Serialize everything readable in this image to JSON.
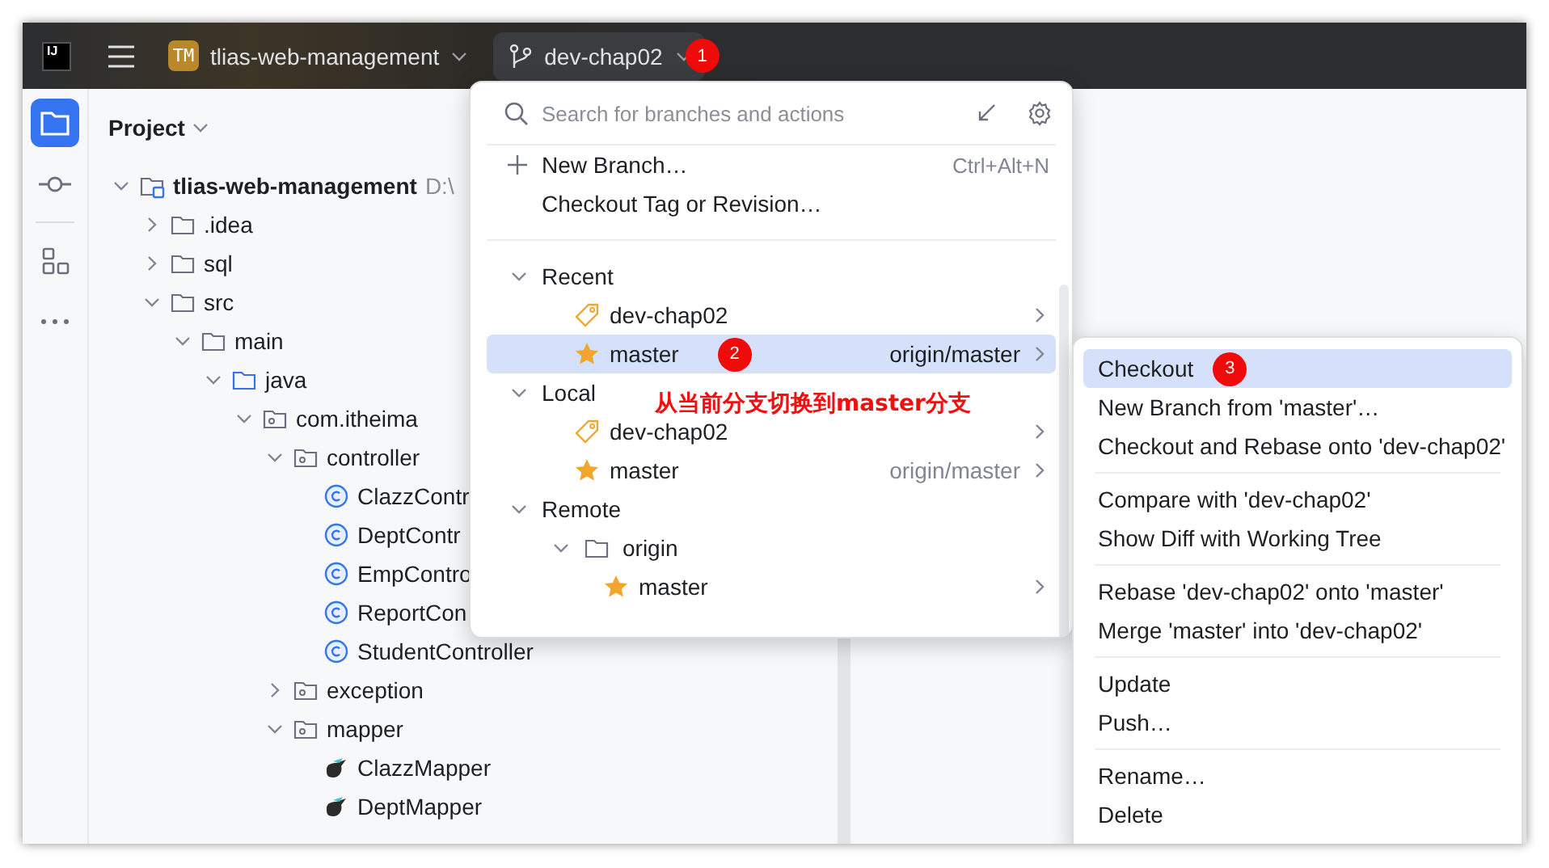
{
  "title_bar": {
    "logo_text": "IJ",
    "project_badge": "TM",
    "project_name": "tlias-web-management",
    "branch": "dev-chap02",
    "branch_badge": "1"
  },
  "tool_strip": [
    {
      "kind": "project",
      "selected": true
    },
    {
      "kind": "commit",
      "selected": false
    },
    {
      "kind": "structure",
      "selected": false
    },
    {
      "kind": "more",
      "selected": false
    }
  ],
  "project_panel": {
    "title": "Project",
    "tree": [
      {
        "label": "tlias-web-management",
        "path": "D:\\",
        "kind": "module",
        "expanded": true,
        "children": [
          {
            "label": ".idea",
            "kind": "folder",
            "expanded": false
          },
          {
            "label": "sql",
            "kind": "folder",
            "expanded": false
          },
          {
            "label": "src",
            "kind": "folder",
            "expanded": true,
            "children": [
              {
                "label": "main",
                "kind": "folder",
                "expanded": true,
                "children": [
                  {
                    "label": "java",
                    "kind": "source-folder",
                    "expanded": true,
                    "children": [
                      {
                        "label": "com.itheima",
                        "kind": "package",
                        "expanded": true,
                        "children": [
                          {
                            "label": "controller",
                            "kind": "package",
                            "expanded": true,
                            "children": [
                              {
                                "label": "ClazzContr",
                                "kind": "class"
                              },
                              {
                                "label": "DeptContr",
                                "kind": "class"
                              },
                              {
                                "label": "EmpContro",
                                "kind": "class"
                              },
                              {
                                "label": "ReportCon",
                                "kind": "class"
                              },
                              {
                                "label": "StudentController",
                                "kind": "class"
                              }
                            ]
                          },
                          {
                            "label": "exception",
                            "kind": "package",
                            "expanded": false
                          },
                          {
                            "label": "mapper",
                            "kind": "package",
                            "expanded": true,
                            "children": [
                              {
                                "label": "ClazzMapper",
                                "kind": "mapper"
                              },
                              {
                                "label": "DeptMapper",
                                "kind": "mapper"
                              }
                            ]
                          }
                        ]
                      }
                    ]
                  }
                ]
              }
            ]
          }
        ]
      }
    ]
  },
  "branch_popup": {
    "search": {
      "placeholder": "Search for branches and actions"
    },
    "actions": [
      {
        "label": "New Branch…",
        "shortcut": "Ctrl+Alt+N",
        "kind": "create"
      },
      {
        "label": "Checkout Tag or Revision…",
        "kind": "plain"
      }
    ],
    "sections": [
      {
        "title": "Recent",
        "expanded": true,
        "items": [
          {
            "name": "dev-chap02",
            "kind": "tag",
            "selected": false
          },
          {
            "name": "master",
            "kind": "star",
            "tracking": "origin/master",
            "selected": true,
            "badge": "2"
          }
        ]
      },
      {
        "title": "Local",
        "expanded": true,
        "items": [
          {
            "name": "dev-chap02",
            "kind": "tag",
            "selected": false
          },
          {
            "name": "master",
            "kind": "star",
            "tracking": "origin/master",
            "selected": false
          }
        ]
      },
      {
        "title": "Remote",
        "expanded": true,
        "groups": [
          {
            "name": "origin",
            "expanded": true,
            "items": [
              {
                "name": "master",
                "kind": "star",
                "selected": false
              }
            ]
          }
        ]
      }
    ],
    "note": "从当前分支切换到master分支"
  },
  "context_menu": {
    "groups": [
      [
        {
          "label": "Checkout",
          "selected": true,
          "badge": "3"
        },
        {
          "label": "New Branch from 'master'…",
          "selected": false
        },
        {
          "label": "Checkout and Rebase onto 'dev-chap02'",
          "selected": false
        }
      ],
      [
        {
          "label": "Compare with 'dev-chap02'",
          "selected": false
        },
        {
          "label": "Show Diff with Working Tree",
          "selected": false
        }
      ],
      [
        {
          "label": "Rebase 'dev-chap02' onto 'master'",
          "selected": false
        },
        {
          "label": "Merge 'master' into 'dev-chap02'",
          "selected": false
        }
      ],
      [
        {
          "label": "Update",
          "selected": false
        },
        {
          "label": "Push…",
          "selected": false
        }
      ],
      [
        {
          "label": "Rename…",
          "selected": false
        },
        {
          "label": "Delete",
          "selected": false
        }
      ]
    ]
  }
}
